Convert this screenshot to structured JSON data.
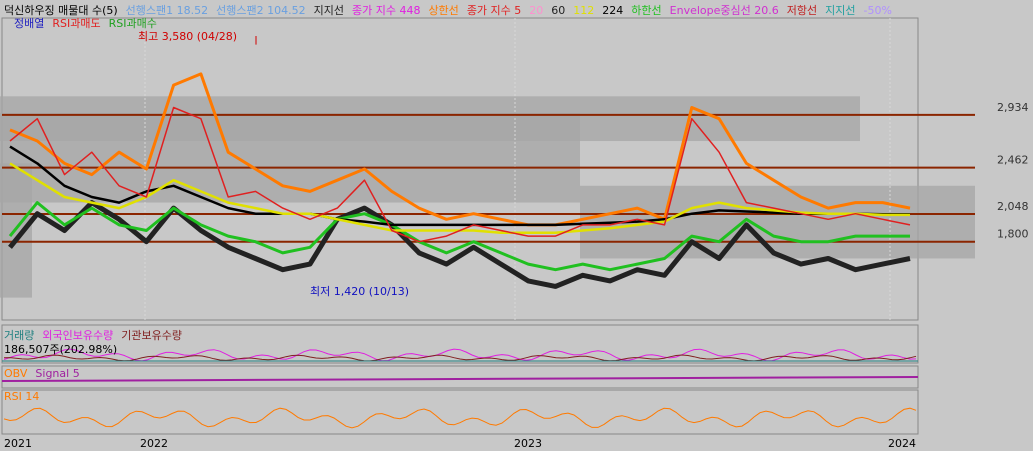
{
  "legend_main": {
    "title": "덕신하우징 매물대 수(5)",
    "items": [
      {
        "label": "선행스팬1 18.52",
        "color": "#6aa0e0"
      },
      {
        "label": "선행스팬2 104.52",
        "color": "#6aa0e0"
      },
      {
        "label": "지지선",
        "color": "#222222"
      },
      {
        "label": "종가 지수 448",
        "color": "#e020e0"
      },
      {
        "label": "상한선",
        "color": "#ff7a00"
      },
      {
        "label": "종가 지수 5",
        "color": "#e02020"
      },
      {
        "label": "20",
        "color": "#ff8fcf"
      },
      {
        "label": "60",
        "color": "#222222"
      },
      {
        "label": "112",
        "color": "#e0e000"
      },
      {
        "label": "224",
        "color": "#000000"
      },
      {
        "label": "하한선",
        "color": "#20c020"
      },
      {
        "label": "Envelope중심선 20.6",
        "color": "#d030d0"
      },
      {
        "label": "저항선",
        "color": "#c02020"
      },
      {
        "label": "지지선",
        "color": "#20a0a0"
      },
      {
        "label": "-50%",
        "color": "#b090ff"
      }
    ],
    "row2": [
      {
        "label": "정배열",
        "color": "#2020c0"
      },
      {
        "label": "RSI과매도",
        "color": "#e02020"
      },
      {
        "label": "RSI과매수",
        "color": "#20a020"
      }
    ]
  },
  "annotations": {
    "high": "최고 3,580 (04/28)",
    "low": "최저 1,420 (10/13)"
  },
  "volume_panel": {
    "legend": [
      {
        "label": "거래량",
        "color": "#208080"
      },
      {
        "label": "외국인보유수량",
        "color": "#e020e0"
      },
      {
        "label": "기관보유수량",
        "color": "#802020"
      }
    ],
    "value_text": "186,507주(202.98%)"
  },
  "obv_panel": {
    "legend": [
      {
        "label": "OBV",
        "color": "#ff7a00"
      },
      {
        "label": "Signal 5",
        "color": "#a020a0"
      }
    ]
  },
  "rsi_panel": {
    "legend": [
      {
        "label": "RSI 14",
        "color": "#ff7a00"
      }
    ]
  },
  "chart_data": {
    "type": "line",
    "x_ticks": [
      "2021",
      "2022",
      "2023",
      "2024"
    ],
    "price_levels": [
      {
        "value": 2934,
        "label": "2,934"
      },
      {
        "value": 2462,
        "label": "2,462"
      },
      {
        "value": 2048,
        "label": "2,048"
      },
      {
        "value": 1800,
        "label": "1,800"
      }
    ],
    "ylim": [
      1100,
      3800
    ],
    "price_high": 3580,
    "price_low": 1420,
    "volume_profile_bands": [
      [
        2700,
        3100
      ],
      [
        2150,
        2950
      ],
      [
        1650,
        2300
      ],
      [
        1300,
        2500
      ]
    ],
    "series": [
      {
        "color": "#222222",
        "values": [
          1750,
          2050,
          1900,
          2150,
          2000,
          1800,
          2100,
          1900,
          1750,
          1650,
          1550,
          1600,
          2000,
          2100,
          1950,
          1700,
          1600,
          1750,
          1600,
          1450,
          1400,
          1500,
          1450,
          1550,
          1500,
          1800,
          1650,
          1950,
          1700,
          1600,
          1650,
          1550,
          1600,
          1650
        ]
      },
      {
        "color": "#20c020",
        "values": [
          1850,
          2150,
          1950,
          2100,
          1950,
          1900,
          2100,
          1950,
          1850,
          1800,
          1700,
          1750,
          2000,
          2050,
          1950,
          1800,
          1700,
          1800,
          1700,
          1600,
          1550,
          1600,
          1550,
          1600,
          1650,
          1850,
          1800,
          2000,
          1850,
          1800,
          1800,
          1850,
          1850,
          1850
        ]
      },
      {
        "color": "#ff7a00",
        "values": [
          2800,
          2700,
          2500,
          2400,
          2600,
          2450,
          3200,
          3300,
          2600,
          2450,
          2300,
          2250,
          2350,
          2450,
          2250,
          2100,
          2000,
          2050,
          2000,
          1950,
          1950,
          2000,
          2050,
          2100,
          2000,
          3000,
          2900,
          2500,
          2350,
          2200,
          2100,
          2150,
          2150,
          2100
        ]
      },
      {
        "color": "#000000",
        "values": [
          2650,
          2500,
          2300,
          2200,
          2150,
          2250,
          2300,
          2200,
          2100,
          2050,
          2050,
          2050,
          2000,
          1980,
          1950,
          1950,
          1950,
          1950,
          1950,
          1950,
          1950,
          1960,
          1970,
          1980,
          2000,
          2050,
          2080,
          2070,
          2060,
          2050,
          2050,
          2050,
          2045,
          2045
        ]
      },
      {
        "color": "#e0e000",
        "values": [
          2500,
          2350,
          2200,
          2150,
          2100,
          2200,
          2350,
          2250,
          2150,
          2100,
          2050,
          2050,
          2000,
          1950,
          1900,
          1900,
          1900,
          1900,
          1880,
          1880,
          1880,
          1900,
          1920,
          1950,
          1980,
          2100,
          2150,
          2100,
          2080,
          2060,
          2050,
          2050,
          2040,
          2040
        ]
      },
      {
        "color": "#e02020",
        "values": [
          2700,
          2900,
          2400,
          2600,
          2300,
          2200,
          3000,
          2900,
          2200,
          2250,
          2100,
          2000,
          2100,
          2350,
          1900,
          1800,
          1850,
          1950,
          1900,
          1850,
          1850,
          1950,
          1950,
          2000,
          1950,
          2900,
          2600,
          2150,
          2100,
          2050,
          2000,
          2050,
          2000,
          1950
        ]
      }
    ]
  }
}
